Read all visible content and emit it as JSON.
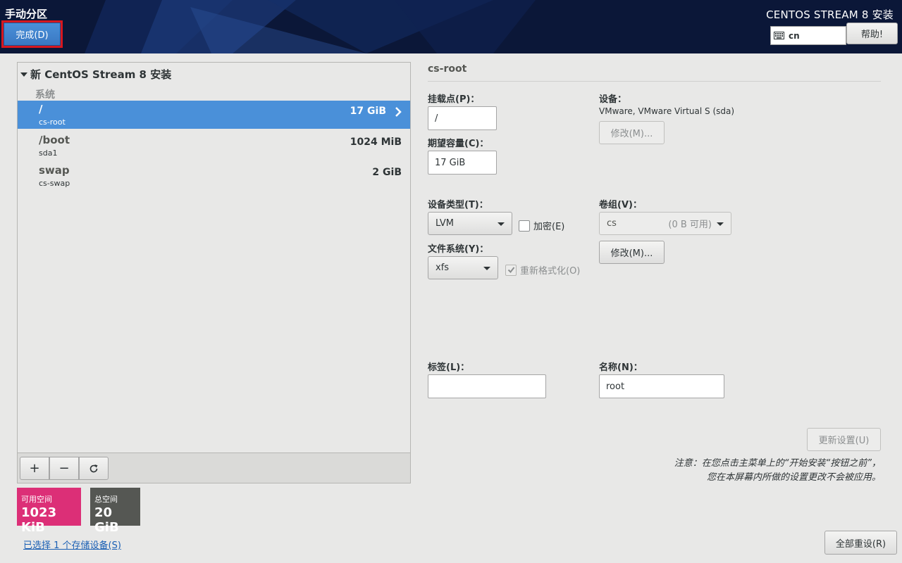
{
  "header": {
    "page_title": "手动分区",
    "done_label": "完成(D)",
    "product_title": "CENTOS STREAM 8 安装",
    "keyboard_layout": "cn",
    "help_label": "帮助!"
  },
  "tree": {
    "header": "新 CentOS Stream 8 安装",
    "group": "系统",
    "partitions": [
      {
        "mount": "/",
        "device": "cs-root",
        "size": "17 GiB",
        "selected": true
      },
      {
        "mount": "/boot",
        "device": "sda1",
        "size": "1024 MiB",
        "selected": false
      },
      {
        "mount": "swap",
        "device": "cs-swap",
        "size": "2 GiB",
        "selected": false
      }
    ]
  },
  "toolbar": {
    "add_label": "+",
    "remove_label": "−"
  },
  "space": {
    "available_label": "可用空间",
    "available_value": "1023 KiB",
    "total_label": "总空间",
    "total_value": "20 GiB"
  },
  "storage_link": "已选择 1 个存储设备(S)",
  "reset_all_label": "全部重设(R)",
  "detail": {
    "title": "cs-root",
    "mount_point_label": "挂载点(P)：",
    "mount_point_value": "/",
    "capacity_label": "期望容量(C)：",
    "capacity_value": "17 GiB",
    "device_label": "设备：",
    "device_value": "VMware, VMware Virtual S (sda)",
    "device_modify_label": "修改(M)...",
    "device_type_label": "设备类型(T)：",
    "device_type_value": "LVM",
    "encrypt_label": "加密(E)",
    "filesystem_label": "文件系统(Y)：",
    "filesystem_value": "xfs",
    "reformat_label": "重新格式化(O)",
    "vg_label": "卷组(V)：",
    "vg_name": "cs",
    "vg_free": "(0 B 可用)",
    "vg_modify_label": "修改(M)...",
    "tag_label": "标签(L)：",
    "tag_value": "",
    "name_label": "名称(N)：",
    "name_value": "root",
    "update_label": "更新设置(U)",
    "note_line1": "注意：在您点击主菜单上的“开始安装“按钮之前”，",
    "note_line2": "您在本屏幕内所做的设置更改不会被应用。"
  },
  "colors": {
    "selected_row": "#4a90d9",
    "available_space": "#dc2f77",
    "total_space": "#555753",
    "header_bg": "#0b1738",
    "done_highlight": "#d7171f"
  }
}
